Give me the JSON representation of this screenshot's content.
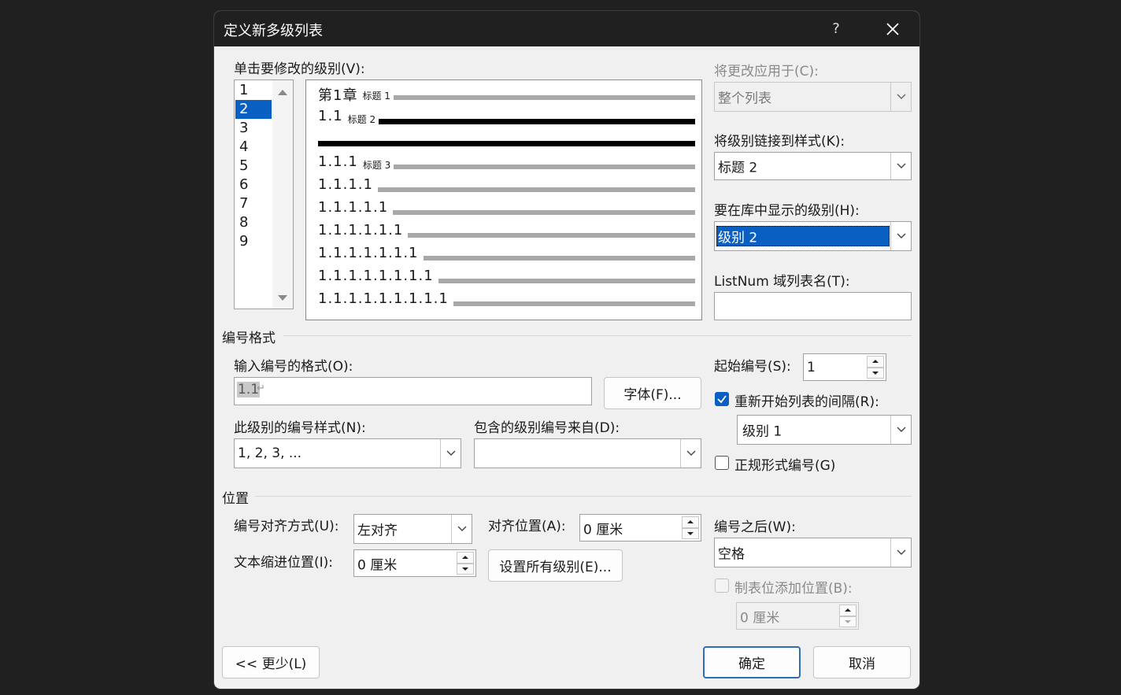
{
  "dialog": {
    "title": "定义新多级列表",
    "help": "?"
  },
  "levels": {
    "label": "单击要修改的级别(V):",
    "items": [
      "1",
      "2",
      "3",
      "4",
      "5",
      "6",
      "7",
      "8",
      "9"
    ],
    "selected_index": 1
  },
  "preview": {
    "rows": [
      {
        "num": "第1章",
        "style": "标题 1"
      },
      {
        "num": "1.1",
        "style": "标题 2"
      },
      {
        "num": "1.1.1",
        "style": "标题 3"
      },
      {
        "num": "1.1.1.1",
        "style": ""
      },
      {
        "num": "1.1.1.1.1",
        "style": ""
      },
      {
        "num": "1.1.1.1.1.1",
        "style": ""
      },
      {
        "num": "1.1.1.1.1.1.1",
        "style": ""
      },
      {
        "num": "1.1.1.1.1.1.1.1",
        "style": ""
      },
      {
        "num": "1.1.1.1.1.1.1.1.1",
        "style": ""
      }
    ]
  },
  "right_top": {
    "apply_to_label": "将更改应用于(C):",
    "apply_to_value": "整个列表",
    "link_style_label": "将级别链接到样式(K):",
    "link_style_value": "标题 2",
    "gallery_level_label": "要在库中显示的级别(H):",
    "gallery_level_value": "级别 2",
    "listnum_label": "ListNum 域列表名(T):",
    "listnum_value": ""
  },
  "number_format": {
    "section": "编号格式",
    "format_label": "输入编号的格式(O):",
    "format_value": "1.1",
    "font_button": "字体(F)...",
    "style_label": "此级别的编号样式(N):",
    "style_value": "1, 2, 3, ...",
    "include_label": "包含的级别编号来自(D):",
    "include_value": "",
    "start_label": "起始编号(S):",
    "start_value": "1",
    "restart_label": "重新开始列表的间隔(R):",
    "restart_checked": true,
    "restart_value": "级别 1",
    "legal_label": "正规形式编号(G)",
    "legal_checked": false
  },
  "position": {
    "section": "位置",
    "align_label": "编号对齐方式(U):",
    "align_value": "左对齐",
    "align_at_label": "对齐位置(A):",
    "align_at_value": "0 厘米",
    "indent_label": "文本缩进位置(I):",
    "indent_value": "0 厘米",
    "set_all_button": "设置所有级别(E)...",
    "follow_label": "编号之后(W):",
    "follow_value": "空格",
    "tab_stop_label": "制表位添加位置(B):",
    "tab_stop_checked": false,
    "tab_stop_value": "0 厘米"
  },
  "buttons": {
    "less": "<< 更少(L)",
    "ok": "确定",
    "cancel": "取消"
  },
  "colors": {
    "accent": "#0a5fc2",
    "titlebar": "#202020",
    "dialog_bg": "#f0f0f0"
  }
}
